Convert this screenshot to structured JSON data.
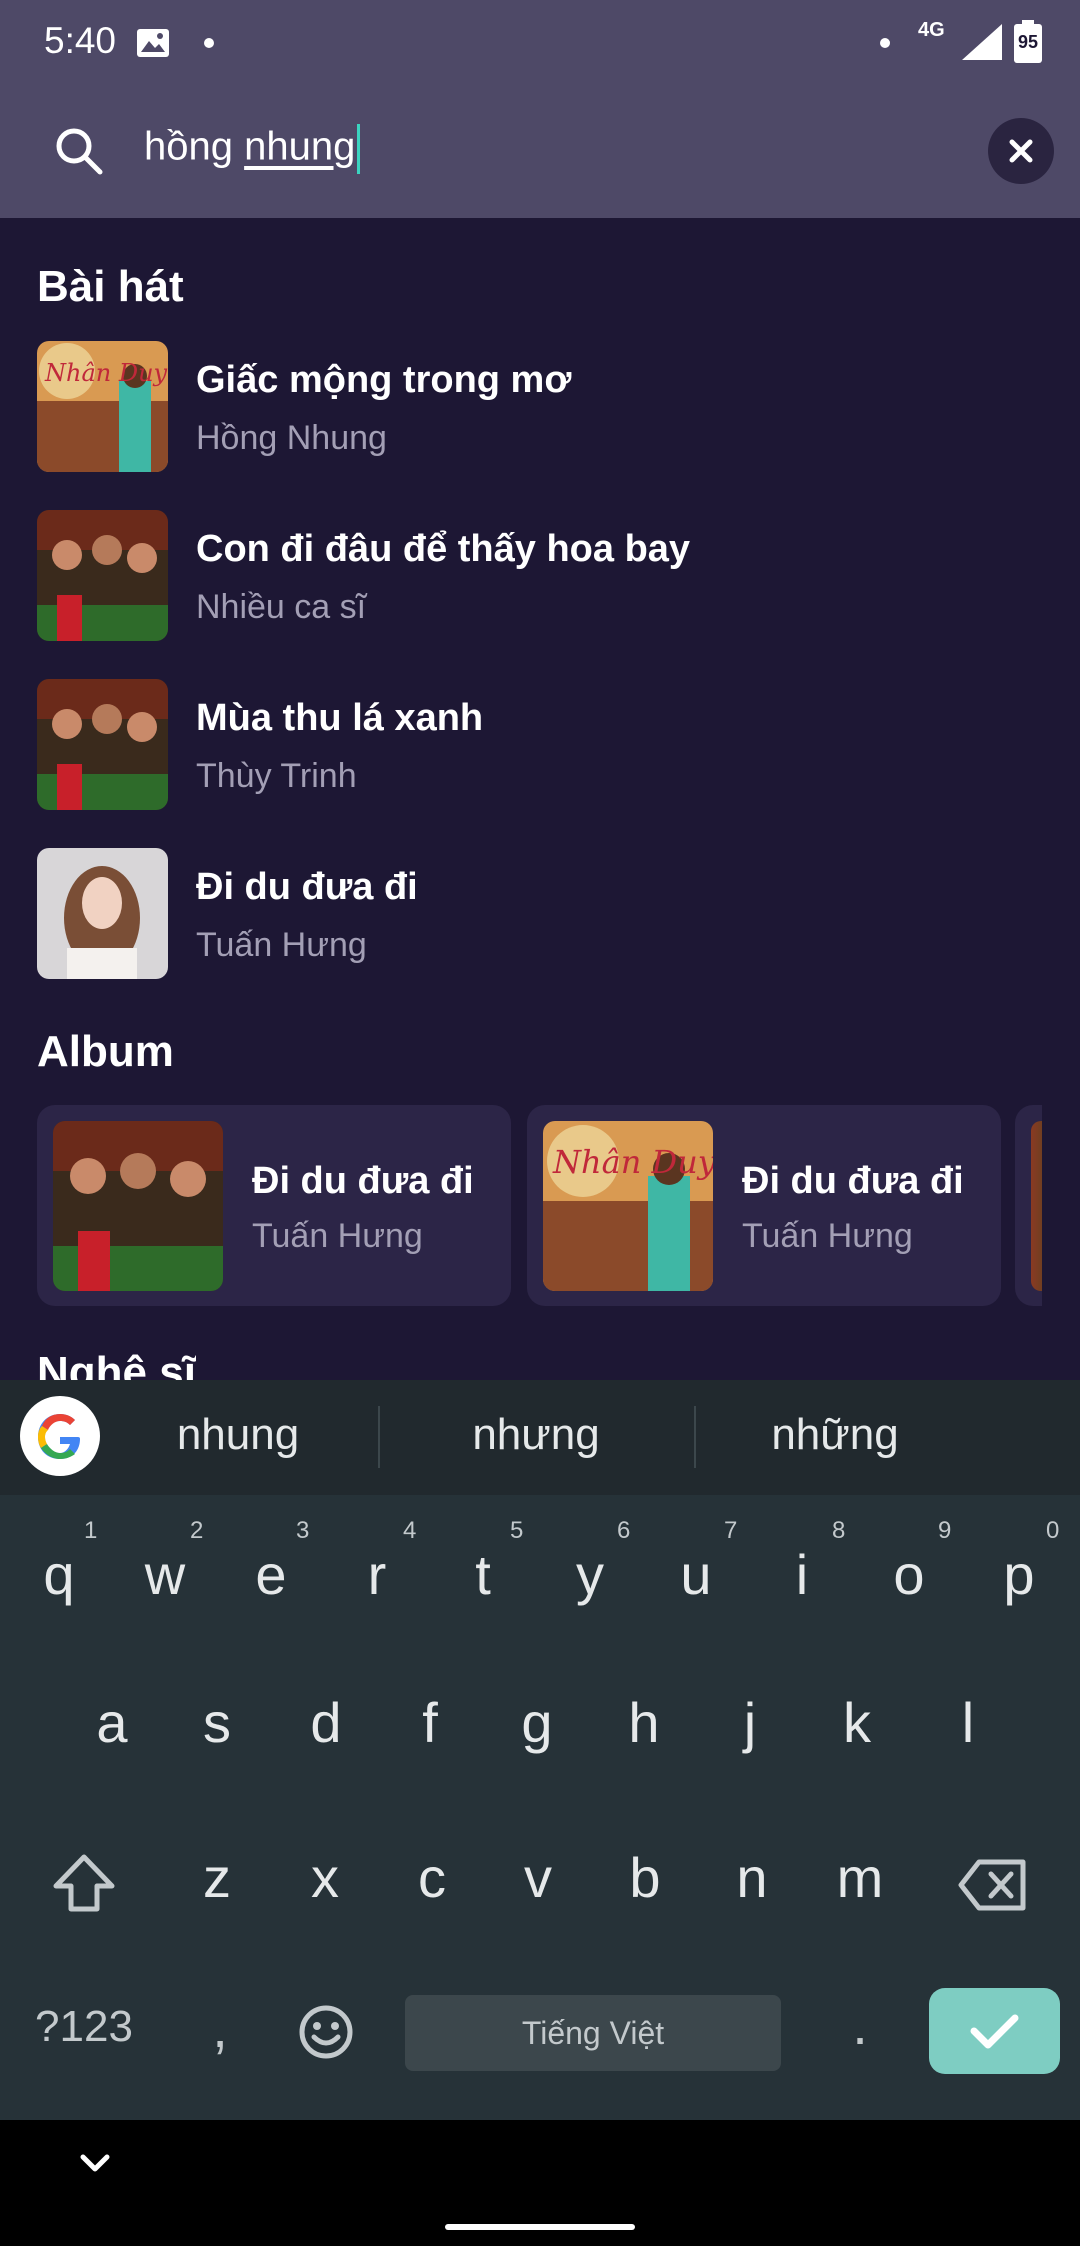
{
  "status_bar": {
    "time": "5:40",
    "network": "4G",
    "battery": "95"
  },
  "search": {
    "query_plain": "hồng ",
    "query_underlined": "nhung"
  },
  "sections": {
    "songs_title": "Bài hát",
    "album_title": "Album",
    "next_title": "Nghệ sĩ"
  },
  "songs": [
    {
      "title": "Giấc mộng trong mơ",
      "artist": "Hồng Nhung"
    },
    {
      "title": "Con đi đâu để thấy hoa bay",
      "artist": "Nhiều ca sĩ"
    },
    {
      "title": "Mùa thu lá xanh",
      "artist": "Thùy Trinh"
    },
    {
      "title": "Đi du đưa đi",
      "artist": "Tuấn Hưng"
    }
  ],
  "albums": [
    {
      "title": "Đi du đưa đi",
      "artist": "Tuấn Hưng"
    },
    {
      "title": "Đi du đưa đi",
      "artist": "Tuấn Hưng"
    }
  ],
  "album_art_text": "Nhân Duyên",
  "keyboard": {
    "suggestions": [
      "nhung",
      "nhưng",
      "những"
    ],
    "row1": [
      "q",
      "w",
      "e",
      "r",
      "t",
      "y",
      "u",
      "i",
      "o",
      "p"
    ],
    "row1_nums": [
      "1",
      "2",
      "3",
      "4",
      "5",
      "6",
      "7",
      "8",
      "9",
      "0"
    ],
    "row2": [
      "a",
      "s",
      "d",
      "f",
      "g",
      "h",
      "j",
      "k",
      "l"
    ],
    "row3": [
      "z",
      "x",
      "c",
      "v",
      "b",
      "n",
      "m"
    ],
    "symbols_label": "?123",
    "comma": ",",
    "period": ".",
    "space_label": "Tiếng Việt"
  },
  "colors": {
    "accent_caret": "#3bd4c0",
    "enter_key": "#7ecdc2",
    "background": "#1d1734",
    "header": "#4e4967"
  }
}
